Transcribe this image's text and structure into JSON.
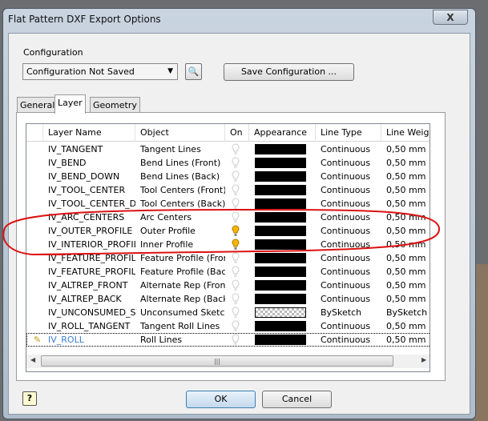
{
  "window": {
    "title": "Flat Pattern DXF Export Options",
    "close_label": "X"
  },
  "configuration": {
    "label": "Configuration",
    "selected": "Configuration Not Saved",
    "save_label": "Save Configuration ..."
  },
  "tabs": [
    {
      "label": "General"
    },
    {
      "label": "Layer",
      "active": true
    },
    {
      "label": "Geometry"
    }
  ],
  "table": {
    "columns": [
      "Layer Name",
      "Object",
      "On",
      "Appearance",
      "Line Type",
      "Line Weight"
    ],
    "rows": [
      {
        "layer": "IV_TANGENT",
        "object": "Tangent Lines",
        "on": false,
        "appearance": "black",
        "line_type": "Continuous",
        "line_weight": "0,50 mm"
      },
      {
        "layer": "IV_BEND",
        "object": "Bend Lines (Front)",
        "on": false,
        "appearance": "black",
        "line_type": "Continuous",
        "line_weight": "0,50 mm"
      },
      {
        "layer": "IV_BEND_DOWN",
        "object": "Bend Lines (Back)",
        "on": false,
        "appearance": "black",
        "line_type": "Continuous",
        "line_weight": "0,50 mm"
      },
      {
        "layer": "IV_TOOL_CENTER",
        "object": "Tool Centers (Front)",
        "on": false,
        "appearance": "black",
        "line_type": "Continuous",
        "line_weight": "0,50 mm"
      },
      {
        "layer": "IV_TOOL_CENTER_DOWN",
        "object": "Tool Centers (Back)",
        "on": false,
        "appearance": "black",
        "line_type": "Continuous",
        "line_weight": "0,50 mm"
      },
      {
        "layer": "IV_ARC_CENTERS",
        "object": "Arc Centers",
        "on": false,
        "appearance": "black",
        "line_type": "Continuous",
        "line_weight": "0,50 mm"
      },
      {
        "layer": "IV_OUTER_PROFILE",
        "object": "Outer Profile",
        "on": true,
        "appearance": "black",
        "line_type": "Continuous",
        "line_weight": "0,50 mm"
      },
      {
        "layer": "IV_INTERIOR_PROFILES",
        "object": "Inner Profile",
        "on": true,
        "appearance": "black",
        "line_type": "Continuous",
        "line_weight": "0,50 mm"
      },
      {
        "layer": "IV_FEATURE_PROFILES",
        "object": "Feature Profile (Front)",
        "on": false,
        "appearance": "black",
        "line_type": "Continuous",
        "line_weight": "0,50 mm"
      },
      {
        "layer": "IV_FEATURE_PROFILES_DOWN",
        "object": "Feature Profile (Back)",
        "on": false,
        "appearance": "black",
        "line_type": "Continuous",
        "line_weight": "0,50 mm"
      },
      {
        "layer": "IV_ALTREP_FRONT",
        "object": "Alternate Rep (Front)",
        "on": false,
        "appearance": "black",
        "line_type": "Continuous",
        "line_weight": "0,50 mm"
      },
      {
        "layer": "IV_ALTREP_BACK",
        "object": "Alternate Rep (Back)",
        "on": false,
        "appearance": "black",
        "line_type": "Continuous",
        "line_weight": "0,50 mm"
      },
      {
        "layer": "IV_UNCONSUMED_SKETCHES",
        "object": "Unconsumed Sketches",
        "on": false,
        "appearance": "bysketch",
        "line_type": "BySketch",
        "line_weight": "BySketch"
      },
      {
        "layer": "IV_ROLL_TANGENT",
        "object": "Tangent Roll Lines",
        "on": false,
        "appearance": "black",
        "line_type": "Continuous",
        "line_weight": "0,50 mm"
      },
      {
        "layer": "IV_ROLL",
        "object": "Roll Lines",
        "on": false,
        "appearance": "black",
        "line_type": "Continuous",
        "line_weight": "0,50 mm",
        "editing": true
      }
    ]
  },
  "buttons": {
    "ok": "OK",
    "cancel": "Cancel",
    "help": "?"
  },
  "colors": {
    "annotation": "#dd1111",
    "bulb_on": "#f5b800",
    "selected_text": "#3a7fd0"
  }
}
